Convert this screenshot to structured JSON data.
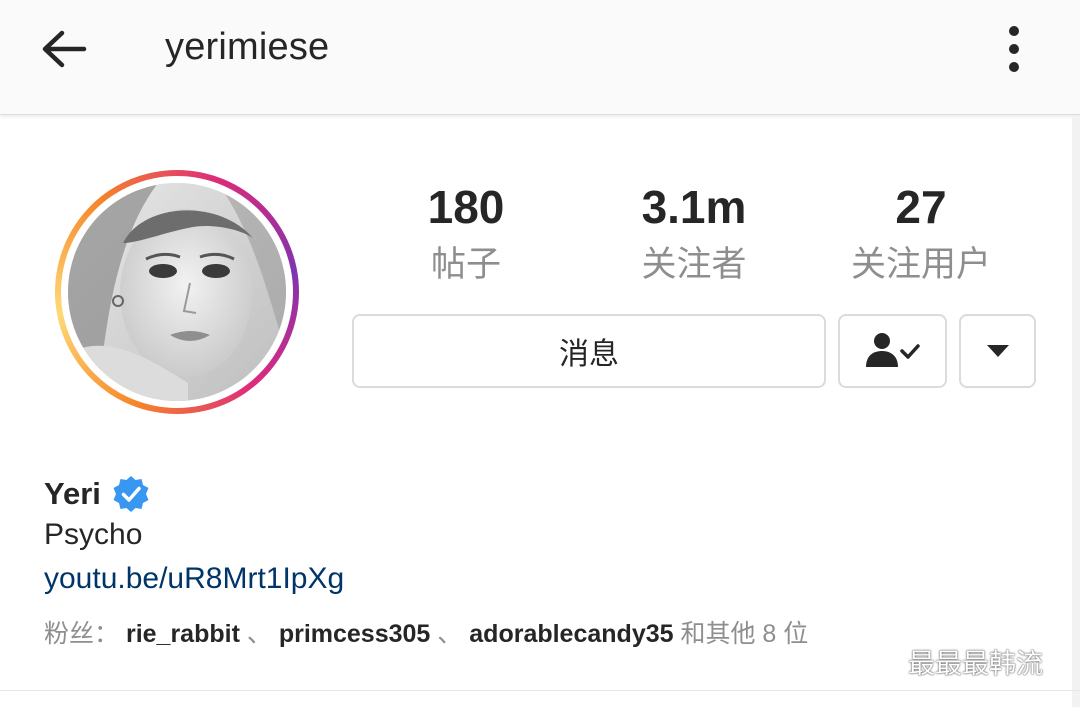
{
  "header": {
    "username": "yerimiese",
    "back_icon": "arrow-left-icon",
    "more_icon": "more-vertical-icon"
  },
  "stats": [
    {
      "value": "180",
      "label": "帖子"
    },
    {
      "value": "3.1m",
      "label": "关注者"
    },
    {
      "value": "27",
      "label": "关注用户"
    }
  ],
  "actions": {
    "message_label": "消息",
    "follow_icon": "person-check-icon",
    "dropdown_icon": "caret-down-icon"
  },
  "profile": {
    "full_name": "Yeri",
    "verified_icon": "verified-badge-icon",
    "bio": "Psycho",
    "link": "youtu.be/uR8Mrt1IpXg"
  },
  "followed_by": {
    "prefix": "粉丝：",
    "users": [
      "rie_rabbit",
      "primcess305",
      "adorablecandy35"
    ],
    "separator": "、",
    "suffix": " 和其他 8 位"
  },
  "watermark": {
    "text": "最最最韩流",
    "icon": "wechat-icon"
  },
  "colors": {
    "link": "#003569",
    "verified": "#3897f0",
    "muted": "#8e8e8e"
  }
}
